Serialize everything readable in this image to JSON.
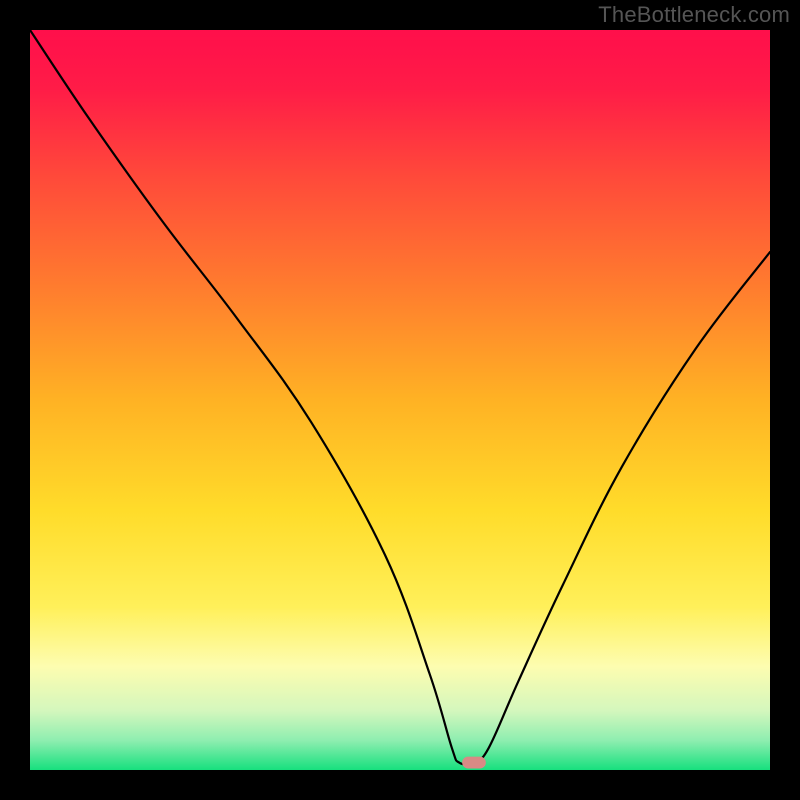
{
  "watermark": "TheBottleneck.com",
  "chart_data": {
    "type": "line",
    "title": "",
    "xlabel": "",
    "ylabel": "",
    "xlim": [
      0,
      100
    ],
    "ylim": [
      0,
      100
    ],
    "grid": false,
    "legend": false,
    "series": [
      {
        "name": "bottleneck-curve",
        "color": "#000000",
        "x": [
          0,
          8,
          18,
          28,
          38,
          48,
          54,
          57,
          58,
          60,
          62,
          66,
          72,
          80,
          90,
          100
        ],
        "values": [
          100,
          88,
          74,
          61,
          47,
          29,
          13,
          3,
          1,
          1,
          3,
          12,
          25,
          41,
          57,
          70
        ]
      }
    ],
    "marker": {
      "x": 60,
      "y": 1,
      "color": "#d88a85",
      "width": 3.2,
      "height": 1.6
    },
    "background": {
      "type": "vertical-gradient",
      "stops": [
        {
          "pos": 0.0,
          "color": "#ff0f4b"
        },
        {
          "pos": 0.08,
          "color": "#ff1c47"
        },
        {
          "pos": 0.2,
          "color": "#ff4a3a"
        },
        {
          "pos": 0.35,
          "color": "#ff7d2e"
        },
        {
          "pos": 0.5,
          "color": "#ffb224"
        },
        {
          "pos": 0.65,
          "color": "#ffdc2a"
        },
        {
          "pos": 0.78,
          "color": "#fff05a"
        },
        {
          "pos": 0.86,
          "color": "#fdfdb0"
        },
        {
          "pos": 0.92,
          "color": "#d4f7bd"
        },
        {
          "pos": 0.96,
          "color": "#8eeeb0"
        },
        {
          "pos": 1.0,
          "color": "#17e07e"
        }
      ]
    }
  }
}
